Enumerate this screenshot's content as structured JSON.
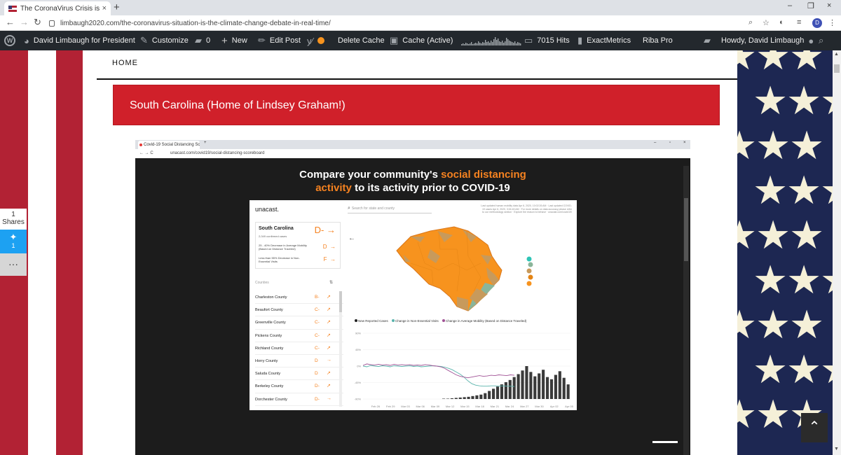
{
  "browser": {
    "tab_title": "The CoronaVirus Crisis is the Clin",
    "new_tab": "+",
    "close": "×",
    "win_min": "–",
    "win_max": "❐",
    "win_close": "×",
    "url": "limbaugh2020.com/the-coronavirus-situation-is-the-climate-change-debate-in-real-time/",
    "profile_initial": "D"
  },
  "adminbar": {
    "site_name": "David Limbaugh for President",
    "customize": "Customize",
    "comments_count": "0",
    "new": "New",
    "edit_post": "Edit Post",
    "delete_cache": "Delete Cache",
    "cache_status": "Cache (Active)",
    "hits": "7015 Hits",
    "exactmetrics": "ExactMetrics",
    "riba": "Riba Pro",
    "howdy": "Howdy, David Limbaugh"
  },
  "share": {
    "count": "1",
    "label": "Shares",
    "twitter_count": "1",
    "more": "···"
  },
  "page": {
    "nav_home": "HOME",
    "banner": "South Carolina (Home of Lindsey Graham!)"
  },
  "embedded": {
    "tab_title": "Covid-19 Social Distancing Score",
    "url": "unacast.com/covid19/social-distancing-scoreboard",
    "heading_part1": "Compare your community's ",
    "heading_highlight1": "social distancing",
    "heading_highlight2": "activity",
    "heading_part2": " to its activity prior to COVID-19",
    "logo": "unacast.",
    "search_placeholder": "Search for state and county",
    "updated_text": "Last updated human mobility data Apr 6, 2020, 10:02:26 AM · Last updated COVID-19 cases Apr 6, 2020, 3:04:43 AM · For more details on data accuracy please refer to our methodology section · Explore the reason to behave · unacast.com/covid19/",
    "state": {
      "name": "South Carolina",
      "cases": "2,049 confirmed cases",
      "grade": "D-",
      "mobility_text": "25 - 40% Decrease in Average Mobility (Based on Distance Traveled)",
      "mobility_grade": "D",
      "visits_text": "Less than 55% Decrease in Non-Essential Visits",
      "visits_grade": "F"
    },
    "counties_header": "Counties",
    "counties": [
      {
        "name": "Charleston County",
        "grade": "B-",
        "trend": "↗"
      },
      {
        "name": "Beaufort County",
        "grade": "C-",
        "trend": "↗"
      },
      {
        "name": "Greenville County",
        "grade": "C-",
        "trend": "↗"
      },
      {
        "name": "Pickens County",
        "grade": "C-",
        "trend": "↗"
      },
      {
        "name": "Richland County",
        "grade": "C-",
        "trend": "↗"
      },
      {
        "name": "Horry County",
        "grade": "D",
        "trend": "→"
      },
      {
        "name": "Saluda County",
        "grade": "D",
        "trend": "↗"
      },
      {
        "name": "Berkeley County",
        "grade": "D-",
        "trend": "↗"
      },
      {
        "name": "Dorchester County",
        "grade": "D-",
        "trend": "→"
      }
    ],
    "legend": {
      "cases": "New Reported Cases",
      "visits": "Change in Non-Essential Visits",
      "mobility": "Change in Average Mobility (Based on Distance Traveled)"
    },
    "grade_dots": [
      "A",
      "B",
      "C",
      "D",
      "F"
    ]
  },
  "colors": {
    "accent_orange": "#f58220",
    "banner_red": "#d0202a",
    "wp_admin": "#23282d",
    "visits_line": "#5ab4ac",
    "mobility_line": "#a05195"
  },
  "chart_data": {
    "type": "bar",
    "x": [
      "Feb 26",
      "Feb 29",
      "Mar 03",
      "Mar 06",
      "Mar 09",
      "Mar 12",
      "Mar 15",
      "Mar 18",
      "Mar 21",
      "Mar 24",
      "Mar 27",
      "Mar 30",
      "Apr 02",
      "Apr 05"
    ],
    "y_ticks": [
      "90%",
      "45%",
      "0%",
      "-45%",
      "-90%"
    ],
    "ylim": [
      -90,
      90
    ],
    "series": [
      {
        "name": "New Reported Cases",
        "kind": "bar",
        "values": [
          0,
          0,
          0,
          0,
          0,
          0,
          0,
          0,
          0,
          0,
          0,
          0,
          0,
          0,
          0,
          0,
          0,
          0,
          0,
          1,
          1,
          2,
          3,
          4,
          5,
          6,
          8,
          10,
          12,
          16,
          22,
          28,
          34,
          40,
          46,
          52,
          60,
          68,
          78,
          90,
          74,
          62,
          70,
          80,
          60,
          54,
          66,
          76,
          58,
          40
        ]
      },
      {
        "name": "Change in Non-Essential Visits",
        "kind": "line",
        "values": [
          0,
          -2,
          2,
          0,
          -1,
          1,
          0,
          -2,
          1,
          0,
          -1,
          0,
          1,
          -1,
          0,
          -2,
          -1,
          0,
          1,
          0,
          -1,
          -3,
          -6,
          -10,
          -16,
          -22,
          -30,
          -40,
          -48,
          -52,
          -54,
          -55,
          -55,
          -54,
          -54,
          -55,
          -54,
          -55,
          -55,
          -56
        ]
      },
      {
        "name": "Change in Average Mobility (Based on Distance Traveled)",
        "kind": "line",
        "values": [
          2,
          6,
          4,
          3,
          5,
          3,
          4,
          2,
          5,
          3,
          4,
          3,
          4,
          2,
          3,
          2,
          4,
          3,
          1,
          0,
          -2,
          -6,
          -12,
          -18,
          -24,
          -28,
          -30,
          -32,
          -30,
          -28,
          -26,
          -28,
          -27,
          -25,
          -26,
          -24,
          -25,
          -26,
          -24,
          -25
        ]
      }
    ]
  }
}
